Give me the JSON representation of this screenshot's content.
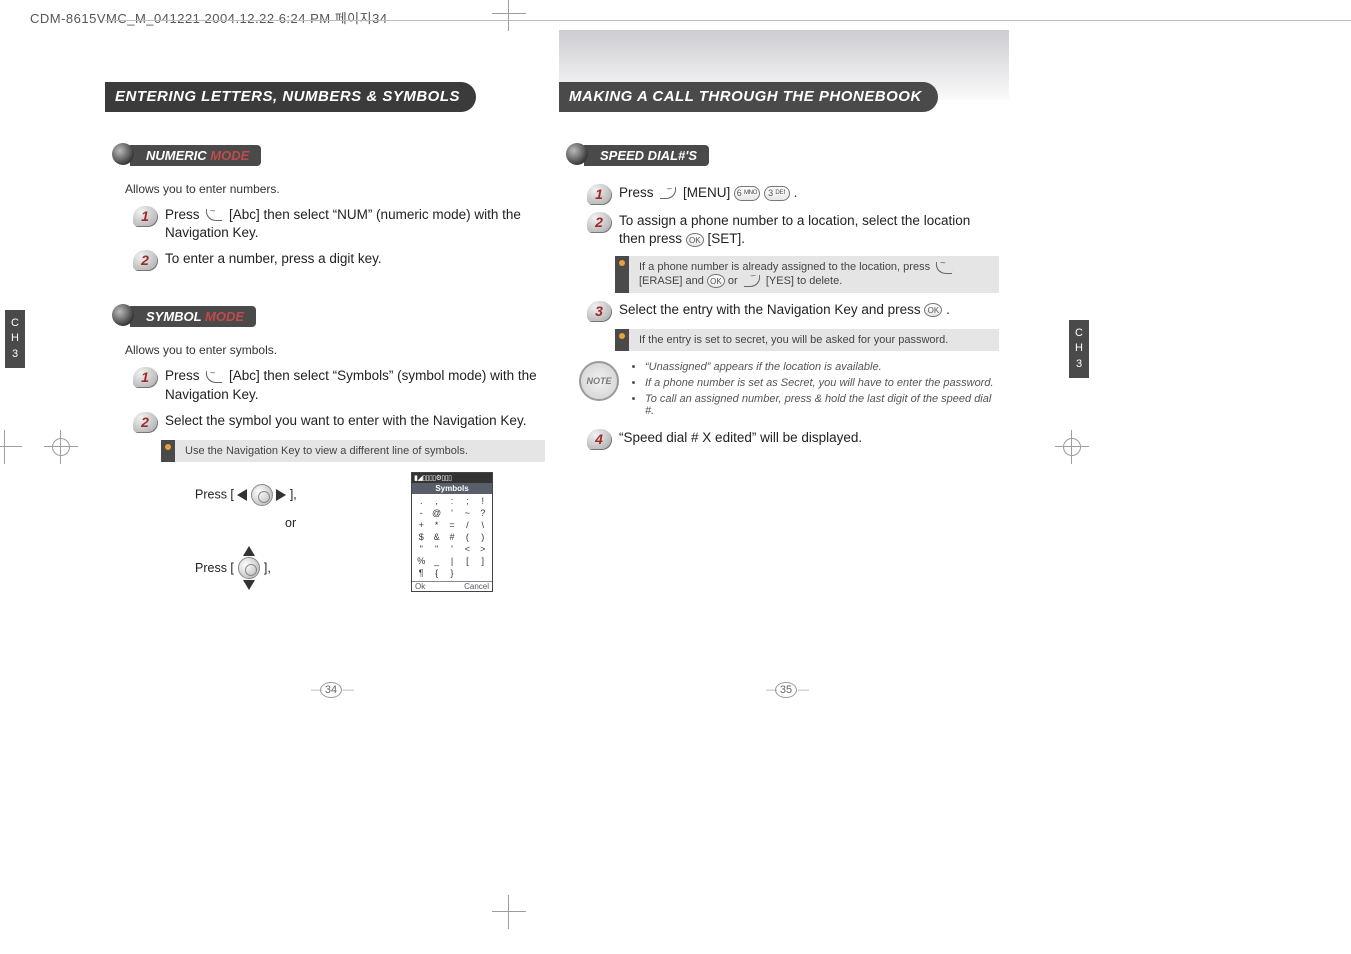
{
  "header_line": "CDM-8615VMC_M_041221  2004.12.22 6:24 PM  페이지34",
  "left_page": {
    "title": "ENTERING LETTERS, NUMBERS & SYMBOLS",
    "numeric": {
      "label_main": "NUMERIC ",
      "label_accent": "MODE",
      "desc": "Allows you to enter numbers.",
      "step1": "Press    [Abc] then select “NUM” (numeric mode) with the Navigation Key.",
      "step2": "To enter a number, press a digit key."
    },
    "symbol": {
      "label_main": "SYMBOL ",
      "label_accent": "MODE",
      "desc": "Allows you to enter symbols.",
      "step1": "Press    [Abc] then select “Symbols” (symbol mode) with the Navigation Key.",
      "step2": "Select the symbol you want to enter with the Navigation Key.",
      "info": "Use the Navigation Key to view a different line of symbols."
    },
    "nav_diagram": {
      "line1_a": "Press [ ",
      "line1_b": " ],",
      "or": "or",
      "line2_a": "Press [",
      "line2_b": "],"
    },
    "phone_screen": {
      "title": "Symbols",
      "cells": [
        ".",
        ",",
        ":",
        ";",
        "!",
        "-",
        "@",
        "'",
        "~",
        "?",
        "+",
        "*",
        "=",
        "/",
        "\\",
        "$",
        "&",
        "#",
        "(",
        ")",
        "\"",
        "\"",
        "'",
        "<",
        ">",
        "%",
        "_",
        "|",
        "[",
        "]",
        "¶",
        "{",
        "}",
        "",
        ""
      ],
      "sk_left": "Ok",
      "sk_right": "Cancel"
    },
    "ch_tab": "C\nH\n3",
    "page_number": "34"
  },
  "right_page": {
    "title": "MAKING A CALL THROUGH THE PHONEBOOK",
    "speed": {
      "label": "SPEED DIAL#'S",
      "step1_a": "Press ",
      "step1_b": " [MENU] ",
      "step1_c": " .",
      "step2": "To assign a phone number to a location, select the location then press    [SET].",
      "info1": "If a phone number is already assigned to the location, press    [ERASE] and    or    [YES] to delete.",
      "step3": "Select the entry with the Navigation Key and press    .",
      "info2": "If the entry is set to secret, you will be asked for your password.",
      "notes": [
        "“Unassigned” appears if the location is available.",
        "If a phone number is set as Secret, you will have to enter the password.",
        "To call an assigned number, press & hold the last digit of the speed dial #."
      ],
      "step4": "“Speed dial # X edited” will be displayed."
    },
    "note_badge": "NOTE",
    "ch_tab": "C\nH\n3",
    "page_number": "35"
  }
}
